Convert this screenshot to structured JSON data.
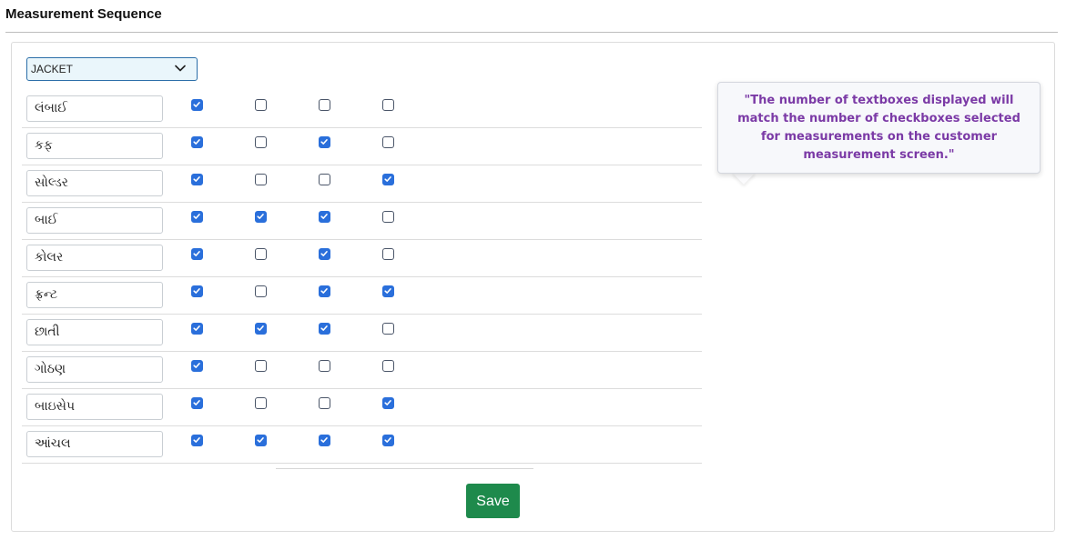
{
  "page": {
    "title": "Measurement Sequence"
  },
  "garment_select": {
    "value": "JACKET"
  },
  "tooltip": {
    "text": "\"The number of textboxes displayed will match the number of checkboxes selected for measurements on the customer measurement screen.\""
  },
  "rows": [
    {
      "label": "લંબાઈ",
      "checks": [
        true,
        false,
        false,
        false
      ]
    },
    {
      "label": "કફ",
      "checks": [
        true,
        false,
        true,
        false
      ]
    },
    {
      "label": "સોલ્ડર",
      "checks": [
        true,
        false,
        false,
        true
      ]
    },
    {
      "label": "બાઈ",
      "checks": [
        true,
        true,
        true,
        false
      ]
    },
    {
      "label": "કોલર",
      "checks": [
        true,
        false,
        true,
        false
      ]
    },
    {
      "label": "ફ્રન્ટ",
      "checks": [
        true,
        false,
        true,
        true
      ]
    },
    {
      "label": "છાતી",
      "checks": [
        true,
        true,
        true,
        false
      ]
    },
    {
      "label": "ગોઠણ",
      "checks": [
        true,
        false,
        false,
        false
      ]
    },
    {
      "label": "બાઇસેપ",
      "checks": [
        true,
        false,
        false,
        true
      ]
    },
    {
      "label": "આંચલ",
      "checks": [
        true,
        true,
        true,
        true
      ]
    }
  ],
  "actions": {
    "save_label": "Save"
  },
  "colors": {
    "accent": "#2a6fdb",
    "save_button": "#1e8a4c",
    "tooltip_text": "#7b3aa6",
    "select_background": "#eaf6fb"
  },
  "icons": {
    "select": "chevron-down-icon",
    "checked": "check-icon"
  }
}
